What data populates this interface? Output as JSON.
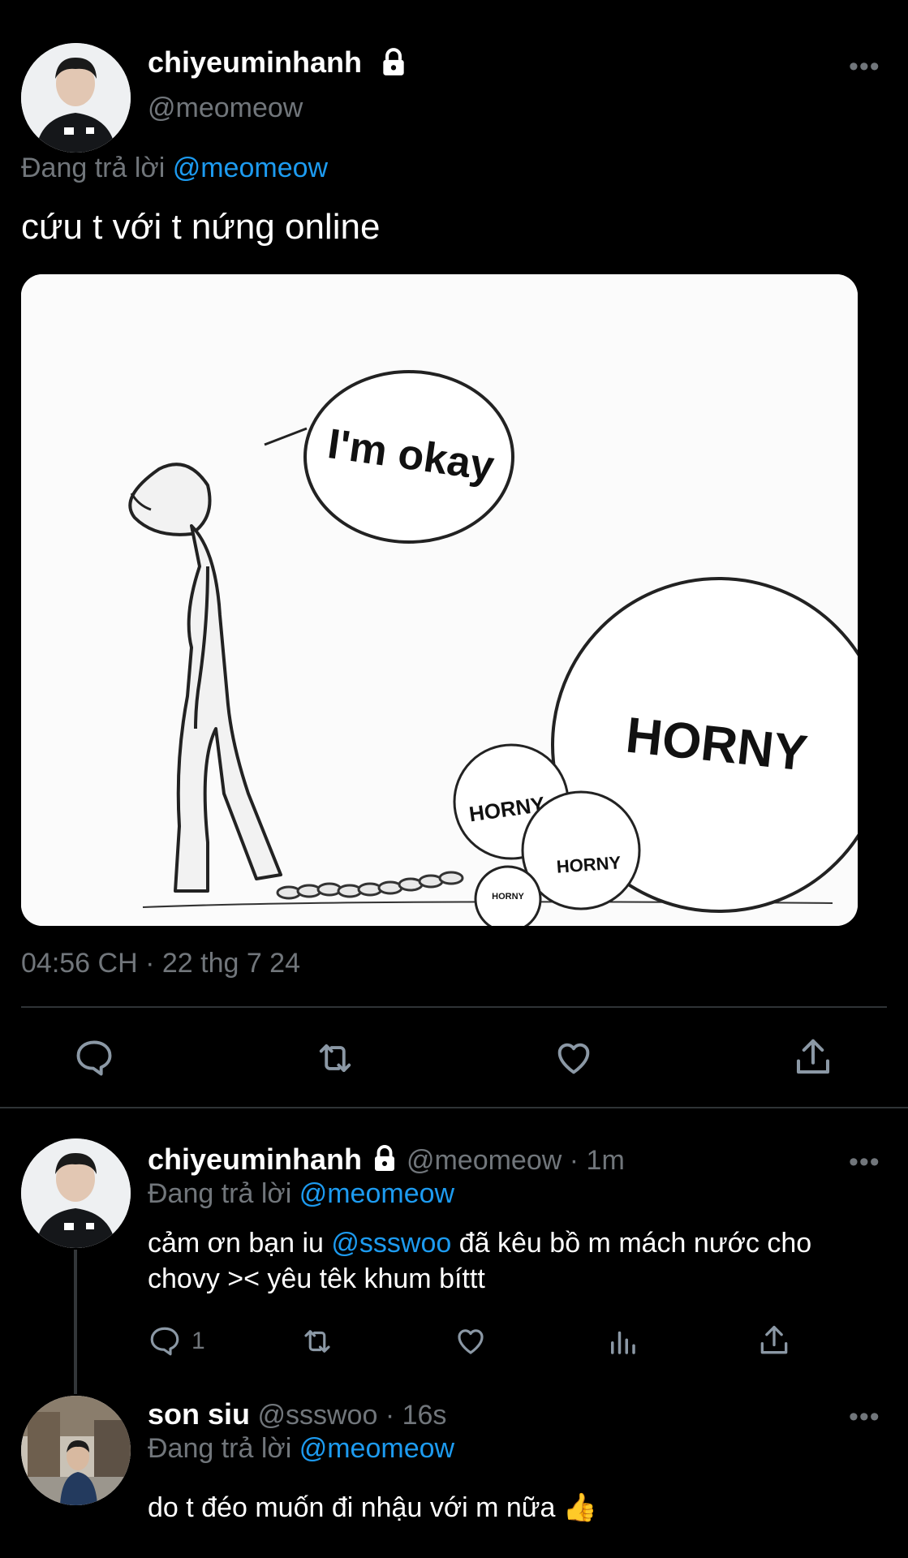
{
  "main_tweet": {
    "display_name": "chiyeuminhanh",
    "handle": "@meomeow",
    "reply_prefix": "Đang trả lời",
    "reply_to": "@meomeow",
    "text": "cứu t với t nứng online",
    "timestamp": "04:56 CH · 22 thg 7 24",
    "meme": {
      "bubble_text": "I'm okay",
      "big_ball": "HORNY",
      "ball_1": "HORNY",
      "ball_2": "HORNY",
      "ball_3": "HORNY"
    },
    "actions": {
      "reply_icon": "reply-icon",
      "retweet_icon": "retweet-icon",
      "like_icon": "heart-icon",
      "share_icon": "share-icon"
    }
  },
  "replies": [
    {
      "display_name": "chiyeuminhanh",
      "handle": "@meomeow",
      "time": "· 1m",
      "reply_prefix": "Đang trả lời",
      "reply_to": "@meomeow",
      "text_pre": "cảm ơn bạn iu ",
      "mention": "@ssswoo",
      "text_post": " đã kêu bồ m mách nước cho chovy >< yêu têk khum bíttt",
      "reply_count": "1"
    },
    {
      "display_name": "son siu",
      "handle": "@ssswoo",
      "time": "· 16s",
      "reply_prefix": "Đang trả lời",
      "reply_to": "@meomeow",
      "text": "do t đéo muốn đi nhậu với m nữa 👍"
    }
  ],
  "colors": {
    "background": "#000000",
    "link": "#1d9bf0",
    "muted": "#71767b",
    "text": "#e7e9ea"
  }
}
